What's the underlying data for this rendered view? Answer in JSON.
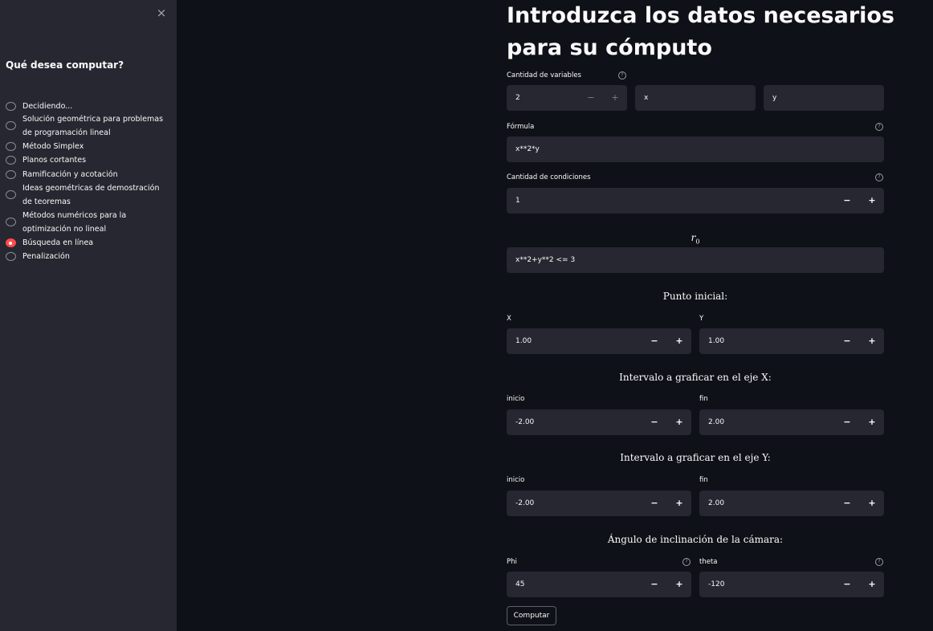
{
  "sidebar": {
    "close_icon": "×",
    "title": "Qué desea computar?",
    "options": [
      "Decidiendo...",
      "Solución geométrica para problemas de programación lineal",
      "Método Simplex",
      "Planos cortantes",
      "Ramificación y acotación",
      "Ideas geométricas de demostración de teoremas",
      "Métodos numéricos para la optimización no lineal",
      "Búsqueda en línea",
      "Penalización"
    ],
    "selected": "Búsqueda en línea"
  },
  "main": {
    "title": "Introduzca los datos necesarios para su cómputo",
    "help_icon": "?",
    "variables": {
      "label": "Cantidad de variables",
      "value": "2",
      "var1": "x",
      "var2": "y"
    },
    "formula": {
      "label": "Fórmula",
      "value": "x**2*y"
    },
    "conditions": {
      "label": "Cantidad de condiciones",
      "value": "1"
    },
    "r0": {
      "symbol": "r",
      "subscript": "0",
      "value": "x**2+y**2 <= 3"
    },
    "initial_point": {
      "heading": "Punto inicial:",
      "x_label": "X",
      "x_value": "1.00",
      "y_label": "Y",
      "y_value": "1.00"
    },
    "x_interval": {
      "heading": "Intervalo a graficar en el eje X:",
      "start_label": "inicio",
      "start_value": "-2.00",
      "end_label": "fin",
      "end_value": "2.00"
    },
    "y_interval": {
      "heading": "Intervalo a graficar en el eje Y:",
      "start_label": "inicio",
      "start_value": "-2.00",
      "end_label": "fin",
      "end_value": "2.00"
    },
    "camera": {
      "heading": "Ángulo de inclinación de la cámara:",
      "phi_label": "Phi",
      "phi_value": "45",
      "theta_label": "theta",
      "theta_value": "-120"
    },
    "stepper": {
      "minus": "−",
      "plus": "+"
    },
    "submit_label": "Computar"
  },
  "colors": {
    "background": "#0e1117",
    "sidebar": "#262730",
    "input": "#262730",
    "accent": "#ff4b4b"
  }
}
